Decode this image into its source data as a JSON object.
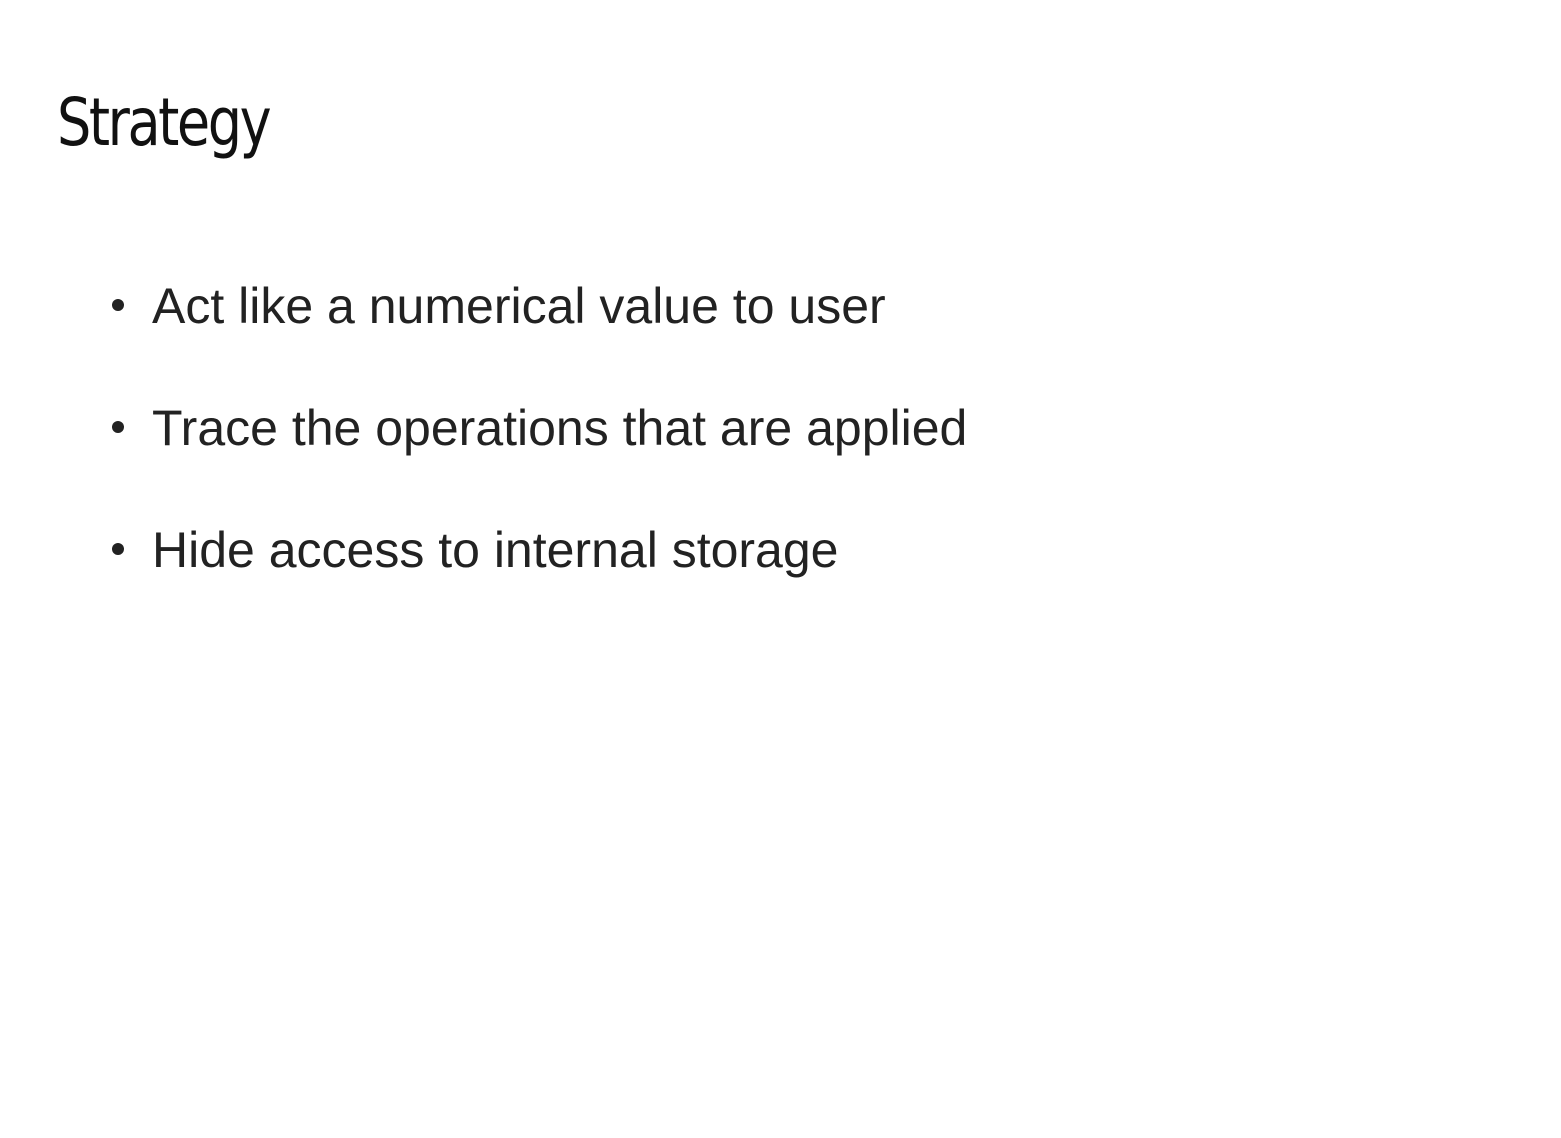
{
  "slide": {
    "title": "Strategy",
    "bullets": [
      {
        "text": "Act like a numerical value to user"
      },
      {
        "text": "Trace the operations that are applied"
      },
      {
        "text": "Hide access to internal storage"
      }
    ]
  },
  "colors": {
    "background": "#ffffff",
    "text": "#222222",
    "title": "#111111"
  }
}
